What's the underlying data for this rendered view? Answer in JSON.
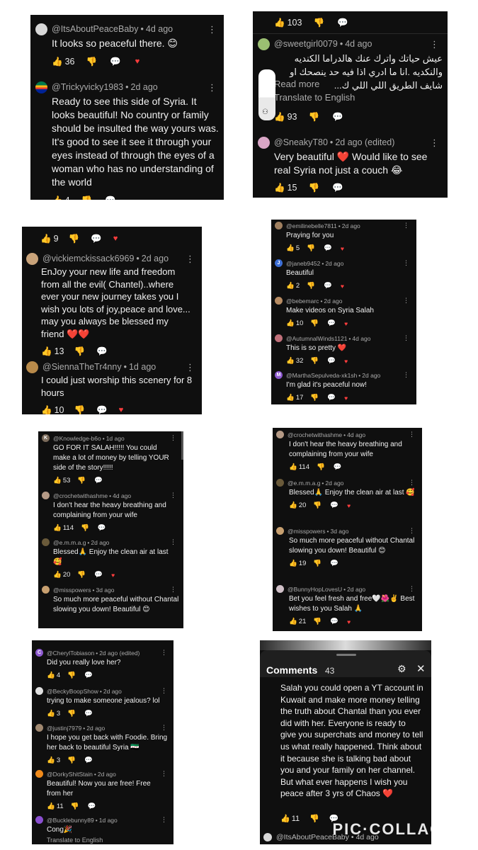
{
  "panels": [
    {
      "id": "p1",
      "comments": [
        {
          "user": "@ItsAboutPeaceBaby",
          "age": "4d ago",
          "text": "It looks so peaceful there. 😊",
          "likes": "36"
        },
        {
          "user": "@Trickyvicky1983",
          "age": "2d ago",
          "text": "Ready to see this side of Syria. It looks beautiful! No country or family should be insulted the way yours was. It's good to see it see it through your eyes instead of through the eyes of a woman who has no understanding of the world",
          "likes": "4"
        }
      ]
    },
    {
      "id": "p2",
      "top_likes": "103",
      "comments": [
        {
          "user": "@sweetgirl0079",
          "age": "4d ago",
          "text": "عيش حياتك واترك عنك هالدراما الكنديه والنكديه .انا ما ادري اذا فيه حد ينصحك او شايف الطريق اللي اللي ك...",
          "read_more": "Read more",
          "translate": "Translate to English",
          "likes": "93"
        },
        {
          "user": "@SneakyT80",
          "age": "2d ago (edited)",
          "text": "Very beautiful ❤️ Would like to see real Syria not just a couch 😂",
          "likes": "15"
        }
      ]
    },
    {
      "id": "p3",
      "top_likes": "9",
      "comments": [
        {
          "user": "@vickiemckissack6969",
          "age": "2d ago",
          "text": "EnJoy your new life and freedom from all the evil( Chantel)..where ever your new journey takes you I wish you lots of joy,peace and love... may you always be blessed my friend ❤️❤️",
          "likes": "13"
        },
        {
          "user": "@SiennaTheTr4nny",
          "age": "1d ago",
          "text": "I could just worship this scenery for 8 hours",
          "likes": "10"
        }
      ]
    },
    {
      "id": "p4",
      "comments": [
        {
          "user": "@emilinebelle7811",
          "age": "2d ago",
          "text": "Praying for you",
          "likes": "5"
        },
        {
          "user": "@janeb9452",
          "age": "2d ago",
          "text": "Beautiful",
          "likes": "2",
          "initial": "J"
        },
        {
          "user": "@bebemarc",
          "age": "2d ago",
          "text": "Make videos on Syria Salah",
          "likes": "10"
        },
        {
          "user": "@AutumnalWinds1121",
          "age": "4d ago",
          "text": "This is so pretty ❤️",
          "likes": "32"
        },
        {
          "user": "@MarthaSepulveda-xk1sh",
          "age": "2d ago",
          "text": "I'm glad it's peaceful now!",
          "likes": "17",
          "initial": "M"
        }
      ]
    },
    {
      "id": "p5",
      "comments": [
        {
          "user": "@Knowledge-b6o",
          "age": "1d ago",
          "text": "GO FOR IT SALAH!!!!! You could make a lot of money by telling YOUR side of the story!!!!!",
          "likes": "53",
          "initial": "K"
        },
        {
          "user": "@crochetwithashme",
          "age": "4d ago",
          "text": "I don't hear the heavy breathing and complaining from your wife",
          "likes": "114"
        },
        {
          "user": "@e.m.m.a.g",
          "age": "2d ago",
          "text": "Blessed🙏 Enjoy the clean air at last 🥰",
          "likes": "20"
        },
        {
          "user": "@misspowers",
          "age": "3d ago",
          "text": "So much more peaceful without Chantal slowing you down! Beautiful 😊",
          "likes": ""
        }
      ]
    },
    {
      "id": "p6",
      "comments": [
        {
          "user": "@crochetwithashme",
          "age": "4d ago",
          "text": "I don't hear the heavy breathing and complaining from your wife",
          "likes": "114"
        },
        {
          "user": "@e.m.m.a.g",
          "age": "2d ago",
          "text": "Blessed🙏 Enjoy the clean air at last 🥰",
          "likes": "20"
        },
        {
          "user": "@misspowers",
          "age": "3d ago",
          "text": "So much more peaceful without Chantal slowing you down! Beautiful 😊",
          "likes": "19"
        },
        {
          "user": "@BunnyHopLovesU",
          "age": "2d ago",
          "text": "Bet you feel fresh and free🤍🌺✌️ Best wishes to you Salah 🙏",
          "likes": "21"
        }
      ]
    },
    {
      "id": "p7",
      "comments": [
        {
          "user": "@CherylTobiason",
          "age": "2d ago (edited)",
          "text": "Did you really love her?",
          "likes": "4",
          "initial": "C"
        },
        {
          "user": "@BeckyBoopShow",
          "age": "2d ago",
          "text": "trying to make someone jealous? lol",
          "likes": "3"
        },
        {
          "user": "@justinj7979",
          "age": "2d ago",
          "text": "I hope you get back with Foodie. Bring her back to beautiful Syria 🇸🇾",
          "likes": "3"
        },
        {
          "user": "@DorkyShitStain",
          "age": "2d ago",
          "text": "Beautiful! Now you are free! Free from her",
          "likes": "11"
        },
        {
          "user": "@Bucklebunny89",
          "age": "1d ago",
          "text": "Cong🎉",
          "likes": "",
          "translate": "Translate to English"
        }
      ]
    },
    {
      "id": "p8",
      "header_title": "Comments",
      "header_count": "43",
      "body": "Salah you could open a YT account in Kuwait and make more money telling the truth about Chantal than you ever did with her. Everyone is ready to give you superchats and money to tell us what really happened. Think about it because she is talking bad about you and your family on her channel. But what ever happens I wish you peace after 3 yrs of Chaos ❤️",
      "likes": "11",
      "footer_user": "@ItsAboutPeaceBaby",
      "footer_age": "4d ago"
    }
  ],
  "watermark": "PIC·COLLAGE",
  "colors": {
    "panel_bg": "#0f0f0f",
    "text": "#f1f1f1",
    "meta": "#aaaaaa",
    "heart": "#ff3d3d"
  }
}
